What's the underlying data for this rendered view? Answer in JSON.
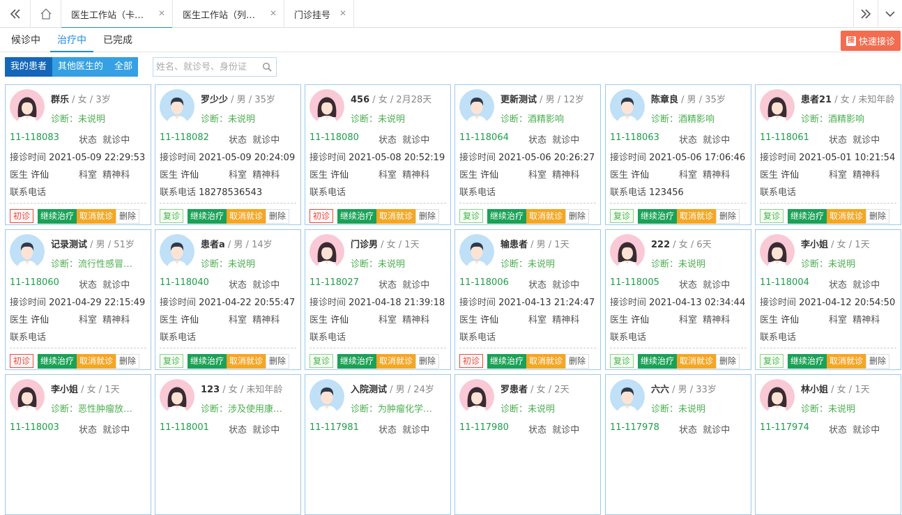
{
  "tabs": [
    {
      "label": "医生工作站（卡…",
      "active": true
    },
    {
      "label": "医生工作站（列…",
      "active": false
    },
    {
      "label": "门诊挂号",
      "active": false
    }
  ],
  "status_tabs": [
    "候诊中",
    "治疗中",
    "已完成"
  ],
  "active_status": "治疗中",
  "quick_btn": {
    "icon": "接",
    "label": "快速接诊"
  },
  "filters": [
    "我的患者",
    "其他医生的",
    "全部"
  ],
  "search_placeholder": "姓名、就诊号、身份证",
  "labels": {
    "status": "状态",
    "time": "接诊时间",
    "doctor": "医生",
    "dept": "科室",
    "phone": "联系电话",
    "continue": "继续治疗",
    "cancel": "取消就诊",
    "delete": "删除"
  },
  "patients": [
    {
      "name": "群乐",
      "meta": " / 女 / 3岁",
      "gender": "female",
      "diag": "诊断：未说明",
      "id": "11-118083",
      "status": "就诊中",
      "time": "2021-05-09 22:29:53",
      "doctor": "许仙",
      "dept": "精神科",
      "phone": "",
      "visit": "初诊"
    },
    {
      "name": "罗少少",
      "meta": " / 男 / 35岁",
      "gender": "male",
      "diag": "诊断：未说明",
      "id": "11-118082",
      "status": "就诊中",
      "time": "2021-05-09 20:24:09",
      "doctor": "许仙",
      "dept": "精神科",
      "phone": "18278536543",
      "visit": "复诊"
    },
    {
      "name": "456",
      "meta": " / 女 / 2月28天",
      "gender": "female",
      "diag": "诊断：未说明",
      "id": "11-118080",
      "status": "就诊中",
      "time": "2021-05-08 20:52:19",
      "doctor": "许仙",
      "dept": "精神科",
      "phone": "",
      "visit": "初诊"
    },
    {
      "name": "更新测试",
      "meta": " / 男 / 12岁",
      "gender": "male",
      "diag": "诊断：酒精影响",
      "id": "11-118064",
      "status": "就诊中",
      "time": "2021-05-06 20:26:27",
      "doctor": "许仙",
      "dept": "精神科",
      "phone": "",
      "visit": "复诊"
    },
    {
      "name": "陈章良",
      "meta": " / 男 / 35岁",
      "gender": "male",
      "diag": "诊断：酒精影响",
      "id": "11-118063",
      "status": "就诊中",
      "time": "2021-05-06 17:06:46",
      "doctor": "许仙",
      "dept": "精神科",
      "phone": "123456",
      "visit": "复诊"
    },
    {
      "name": "患者21",
      "meta": " / 女 / 未知年龄",
      "gender": "female",
      "diag": "诊断：酒精影响",
      "id": "11-118061",
      "status": "就诊中",
      "time": "2021-05-01 10:21:54",
      "doctor": "许仙",
      "dept": "精神科",
      "phone": "",
      "visit": "复诊"
    },
    {
      "name": "记录测试",
      "meta": " / 男 / 51岁",
      "gender": "male",
      "diag": "诊断：流行性感冒…",
      "id": "11-118060",
      "status": "就诊中",
      "time": "2021-04-29 22:15:49",
      "doctor": "许仙",
      "dept": "精神科",
      "phone": "",
      "visit": "初诊"
    },
    {
      "name": "患者a",
      "meta": " / 男 / 14岁",
      "gender": "male",
      "diag": "诊断：未说明",
      "id": "11-118040",
      "status": "就诊中",
      "time": "2021-04-22 20:55:47",
      "doctor": "许仙",
      "dept": "精神科",
      "phone": "",
      "visit": "复诊"
    },
    {
      "name": "门诊男",
      "meta": " / 女 / 1天",
      "gender": "female",
      "diag": "诊断：未说明",
      "id": "11-118027",
      "status": "就诊中",
      "time": "2021-04-18 21:39:18",
      "doctor": "许仙",
      "dept": "精神科",
      "phone": "",
      "visit": "复诊"
    },
    {
      "name": "输患者",
      "meta": " / 男 / 1天",
      "gender": "male",
      "diag": "诊断：未说明",
      "id": "11-118006",
      "status": "就诊中",
      "time": "2021-04-13 21:24:47",
      "doctor": "许仙",
      "dept": "精神科",
      "phone": "",
      "visit": "初诊"
    },
    {
      "name": "222",
      "meta": " / 女 / 6天",
      "gender": "female",
      "diag": "诊断：未说明",
      "id": "11-118005",
      "status": "就诊中",
      "time": "2021-04-13 02:34:44",
      "doctor": "许仙",
      "dept": "精神科",
      "phone": "",
      "visit": "复诊"
    },
    {
      "name": "李小姐",
      "meta": " / 女 / 1天",
      "gender": "female",
      "diag": "诊断：未说明",
      "id": "11-118004",
      "status": "就诊中",
      "time": "2021-04-12 20:54:50",
      "doctor": "许仙",
      "dept": "精神科",
      "phone": "",
      "visit": "复诊"
    },
    {
      "name": "李小姐",
      "meta": " / 女 / 1天",
      "gender": "female",
      "diag": "诊断：恶性肿瘤放…",
      "id": "11-118003",
      "status": "就诊中"
    },
    {
      "name": "123",
      "meta": " / 女 / 未知年龄",
      "gender": "female",
      "diag": "诊断：涉及使用康…",
      "id": "11-118001",
      "status": "就诊中"
    },
    {
      "name": "入院测试",
      "meta": " / 男 / 24岁",
      "gender": "male",
      "diag": "诊断：为肿瘤化学…",
      "id": "11-117981",
      "status": "就诊中"
    },
    {
      "name": "罗患者",
      "meta": " / 女 / 2天",
      "gender": "female",
      "diag": "诊断：未说明",
      "id": "11-117980",
      "status": "就诊中"
    },
    {
      "name": "六六",
      "meta": " / 男 / 33岁",
      "gender": "male",
      "diag": "诊断：未说明",
      "id": "11-117978",
      "status": "就诊中"
    },
    {
      "name": "林小姐",
      "meta": " / 女 / 1天",
      "gender": "female",
      "diag": "诊断：未说明",
      "id": "11-117974",
      "status": "就诊中"
    }
  ]
}
